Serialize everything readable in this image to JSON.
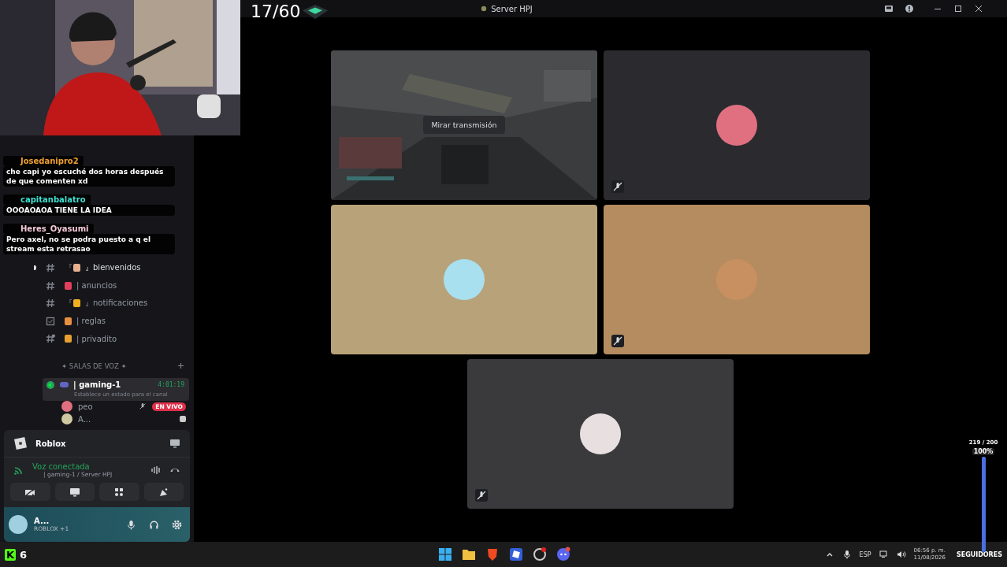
{
  "window": {
    "title": "Server HPJ"
  },
  "overlay": {
    "counter": "17/60",
    "goal": {
      "reading": "219 / 200",
      "percent": "100%",
      "level": 1,
      "label": "SEGUIDORES"
    },
    "viewers": {
      "logo": "K",
      "count": "6"
    }
  },
  "chat": [
    {
      "user": "Josedanipro2",
      "color": "#f0a030",
      "text": "che capi yo escuché dos horas después de que comenten xd"
    },
    {
      "user": "capitanbalatro",
      "color": "#3ee0d0",
      "text": "OOOAOAOA TIENE LA IDEA"
    },
    {
      "user": "Heres_Oyasumi",
      "color": "#f4c8d8",
      "text": "Pero axel, no se podra puesto a q el stream esta retrasao"
    }
  ],
  "channels": [
    {
      "kind": "text",
      "pre": "『",
      "name": "』bienvenidos",
      "unread": true,
      "color": "#e8b090"
    },
    {
      "kind": "text",
      "name": "| anuncios",
      "unread": false,
      "color": "#e0405a"
    },
    {
      "kind": "text",
      "pre": "『",
      "name": "』notificaciones",
      "unread": false,
      "color": "#f0b020"
    },
    {
      "kind": "rules",
      "name": "| reglas",
      "unread": false,
      "color": "#e89040"
    },
    {
      "kind": "locked",
      "name": "| privadito",
      "unread": false,
      "color": "#e8a030"
    }
  ],
  "voice_category": "✦ SALAS DE VOZ ✦",
  "voice_channel": {
    "name": "| gaming-1",
    "timer": "4:01:19",
    "status": "Establece un estado para el canal",
    "members": [
      {
        "name": "peo",
        "muted": true,
        "live": true,
        "live_label": "EN VIVO",
        "color": "#e07080"
      },
      {
        "name": "A...",
        "muted": false,
        "live": false,
        "color": "#d0c8a0"
      }
    ]
  },
  "activity": {
    "name": "Roblox"
  },
  "voice_panel": {
    "status": "Voz conectada",
    "channel": "| gaming-1 / Server HPJ"
  },
  "user": {
    "name": "A...",
    "activity": "ROBLOX +1"
  },
  "tiles": [
    {
      "kind": "stream",
      "button": "Mirar transmisión",
      "muted": false
    },
    {
      "kind": "avatar",
      "color": "#2b2b2f",
      "muted": true
    },
    {
      "kind": "avatar",
      "color": "#b8a27a",
      "muted": false
    },
    {
      "kind": "avatar",
      "color": "#b48c5f",
      "muted": true
    },
    {
      "kind": "avatar",
      "color": "#3a3a3c",
      "muted": true
    }
  ],
  "taskbar": {
    "language": "ESP",
    "time": "06:56 p. m.",
    "date": "11/08/2026"
  }
}
